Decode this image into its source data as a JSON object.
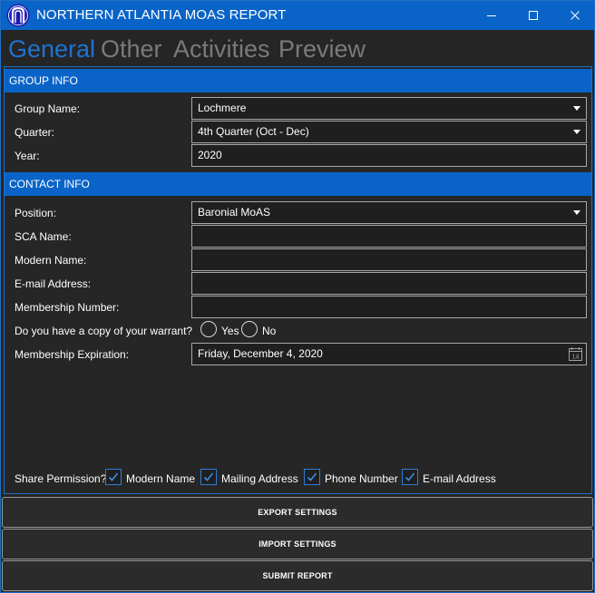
{
  "window": {
    "title": "NORTHERN ATLANTIA MOAS REPORT",
    "accent_color": "#0a64c8",
    "icons": {
      "app": "arch-logo-icon",
      "minimize": "minimize-icon",
      "maximize": "maximize-icon",
      "close": "close-icon"
    }
  },
  "tabs": [
    {
      "label": "General",
      "active": true
    },
    {
      "label": "Other",
      "active": false
    },
    {
      "label": "Activities",
      "active": false
    },
    {
      "label": "Preview",
      "active": false
    }
  ],
  "group_info": {
    "header": "GROUP INFO",
    "group_name_label": "Group Name:",
    "group_name_value": "Lochmere",
    "quarter_label": "Quarter:",
    "quarter_value": "4th Quarter (Oct - Dec)",
    "year_label": "Year:",
    "year_value": "2020"
  },
  "contact_info": {
    "header": "CONTACT INFO",
    "position_label": "Position:",
    "position_value": "Baronial MoAS",
    "sca_name_label": "SCA Name:",
    "sca_name_value": "",
    "modern_name_label": "Modern Name:",
    "modern_name_value": "",
    "email_label": "E-mail Address:",
    "email_value": "",
    "membership_number_label": "Membership Number:",
    "membership_number_value": "",
    "warrant_label": "Do you have a copy of your warrant?",
    "warrant_yes": "Yes",
    "warrant_no": "No",
    "membership_expiration_label": "Membership Expiration:",
    "membership_expiration_value": "Friday, December 4, 2020",
    "calendar_day": "14"
  },
  "share": {
    "label": "Share Permission?",
    "options": [
      {
        "label": "Modern Name",
        "checked": true
      },
      {
        "label": "Mailing Address",
        "checked": true
      },
      {
        "label": "Phone Number",
        "checked": true
      },
      {
        "label": "E-mail Address",
        "checked": true
      }
    ]
  },
  "actions": {
    "export": "EXPORT SETTINGS",
    "import": "IMPORT SETTINGS",
    "submit": "SUBMIT REPORT"
  }
}
